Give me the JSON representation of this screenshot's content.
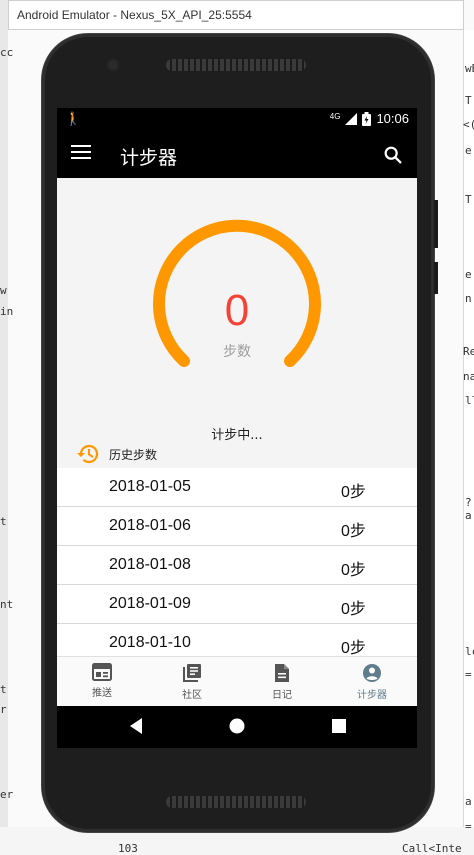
{
  "window": {
    "title": "Android Emulator - Nexus_5X_API_25:5554"
  },
  "ide_fragments": {
    "right": [
      "wB",
      "T",
      "<(",
      "e",
      "T",
      "e",
      "n",
      "Re",
      "na",
      "ll",
      "?a",
      "lc",
      "=",
      "a",
      "="
    ],
    "left": [
      "cc",
      "w",
      "in",
      "t",
      "nt",
      "t",
      "r",
      "er"
    ],
    "bottom": [
      "103",
      "Call<Inte"
    ]
  },
  "status_bar": {
    "network": "4G",
    "time": "10:06"
  },
  "app_bar": {
    "title": "计步器"
  },
  "pedometer": {
    "steps": "0",
    "unit": "步数",
    "status": "计步中...",
    "progress": 0,
    "arc_color": "#ff9800",
    "count_color": "#f44336"
  },
  "history": {
    "header": "历史步数",
    "rows": [
      {
        "date": "2018-01-05",
        "steps": "0步"
      },
      {
        "date": "2018-01-06",
        "steps": "0步"
      },
      {
        "date": "2018-01-08",
        "steps": "0步"
      },
      {
        "date": "2018-01-09",
        "steps": "0步"
      },
      {
        "date": "2018-01-10",
        "steps": "0步"
      }
    ]
  },
  "bottom_nav": {
    "items": [
      {
        "label": "推送",
        "icon": "newspaper-icon"
      },
      {
        "label": "社区",
        "icon": "library-books-icon"
      },
      {
        "label": "日记",
        "icon": "document-icon"
      },
      {
        "label": "计步器",
        "icon": "account-circle-icon"
      }
    ],
    "active_index": 3
  }
}
